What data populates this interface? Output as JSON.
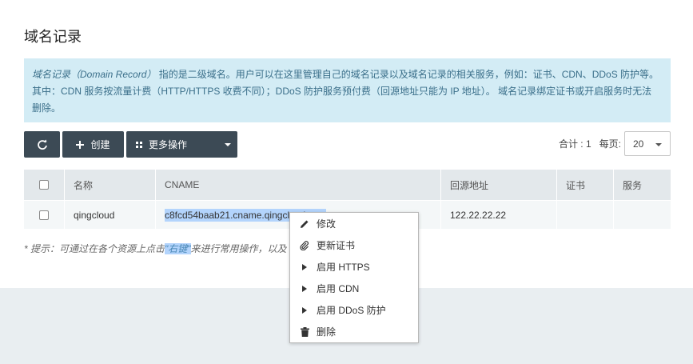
{
  "page": {
    "title": "域名记录"
  },
  "info": {
    "term": "域名记录（Domain Record）",
    "line1_rest": " 指的是二级域名。用户可以在这里管理自己的域名记录以及域名记录的相关服务，例如：证书、CDN、DDoS 防护等。",
    "line2": "其中：CDN 服务按流量计费（HTTP/HTTPS 收费不同）；DDoS 防护服务预付费（回源地址只能为 IP 地址）。 域名记录绑定证书或开启服务时无法",
    "line3": "删除。"
  },
  "toolbar": {
    "refresh_icon": "refresh-icon",
    "create_label": "创建",
    "more_label": "更多操作"
  },
  "pager": {
    "total_label": "合计 : 1",
    "per_page_label": "每页:",
    "per_page_value": "20"
  },
  "table": {
    "headers": {
      "name": "名称",
      "cname": "CNAME",
      "addr": "回源地址",
      "cert": "证书",
      "service": "服务"
    },
    "rows": [
      {
        "name": "qingcloud",
        "cname": "c8fcd54baab21.cname.qingcloud.com",
        "addr": "122.22.22.22",
        "cert": "",
        "service": ""
      }
    ]
  },
  "hint": {
    "prefix": "* 提示：可通过在各个资源上点击",
    "highlight": "\"右键\"",
    "suffix": "来进行常用操作，以及"
  },
  "context_menu": {
    "items": [
      {
        "label": "修改",
        "icon": "pencil-icon"
      },
      {
        "label": "更新证书",
        "icon": "paperclip-icon"
      },
      {
        "label": "启用 HTTPS",
        "icon": "play-icon"
      },
      {
        "label": "启用 CDN",
        "icon": "play-icon"
      },
      {
        "label": "启用 DDoS 防护",
        "icon": "play-icon"
      },
      {
        "label": "删除",
        "icon": "trash-icon"
      }
    ]
  },
  "colors": {
    "info_bg": "#d3ecf5",
    "info_text": "#3b6f8a",
    "button_bg": "#3c4a55",
    "selection": "#b3d4fc"
  }
}
